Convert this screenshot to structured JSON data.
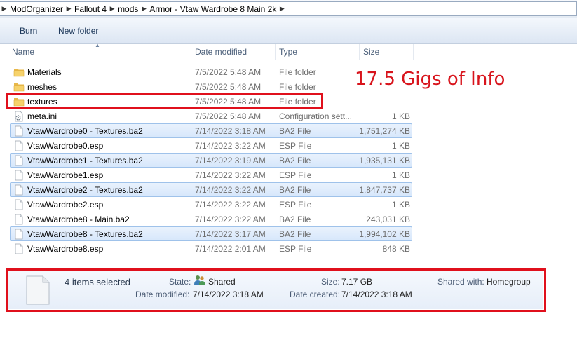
{
  "breadcrumb": [
    "ModOrganizer",
    "Fallout 4",
    "mods",
    "Armor - Vtaw Wardrobe 8 Main 2k"
  ],
  "toolbar": {
    "burn_label": "Burn",
    "new_folder_label": "New folder"
  },
  "columns": {
    "name": "Name",
    "date_modified": "Date modified",
    "type": "Type",
    "size": "Size"
  },
  "files": [
    {
      "name": "Materials",
      "date": "7/5/2022 5:48 AM",
      "type": "File folder",
      "size": "",
      "icon": "folder-icon",
      "selected": false
    },
    {
      "name": "meshes",
      "date": "7/5/2022 5:48 AM",
      "type": "File folder",
      "size": "",
      "icon": "folder-icon",
      "selected": false
    },
    {
      "name": "textures",
      "date": "7/5/2022 5:48 AM",
      "type": "File folder",
      "size": "",
      "icon": "folder-icon",
      "selected": false
    },
    {
      "name": "meta.ini",
      "date": "7/5/2022 5:48 AM",
      "type": "Configuration sett...",
      "size": "1 KB",
      "icon": "settings-file-icon",
      "selected": false
    },
    {
      "name": "VtawWardrobe0 - Textures.ba2",
      "date": "7/14/2022 3:18 AM",
      "type": "BA2 File",
      "size": "1,751,274 KB",
      "icon": "file-icon",
      "selected": true
    },
    {
      "name": "VtawWardrobe0.esp",
      "date": "7/14/2022 3:22 AM",
      "type": "ESP File",
      "size": "1 KB",
      "icon": "file-icon",
      "selected": false
    },
    {
      "name": "VtawWardrobe1 - Textures.ba2",
      "date": "7/14/2022 3:19 AM",
      "type": "BA2 File",
      "size": "1,935,131 KB",
      "icon": "file-icon",
      "selected": true
    },
    {
      "name": "VtawWardrobe1.esp",
      "date": "7/14/2022 3:22 AM",
      "type": "ESP File",
      "size": "1 KB",
      "icon": "file-icon",
      "selected": false
    },
    {
      "name": "VtawWardrobe2 - Textures.ba2",
      "date": "7/14/2022 3:22 AM",
      "type": "BA2 File",
      "size": "1,847,737 KB",
      "icon": "file-icon",
      "selected": true
    },
    {
      "name": "VtawWardrobe2.esp",
      "date": "7/14/2022 3:22 AM",
      "type": "ESP File",
      "size": "1 KB",
      "icon": "file-icon",
      "selected": false
    },
    {
      "name": "VtawWardrobe8 - Main.ba2",
      "date": "7/14/2022 3:22 AM",
      "type": "BA2 File",
      "size": "243,031 KB",
      "icon": "file-icon",
      "selected": false
    },
    {
      "name": "VtawWardrobe8 - Textures.ba2",
      "date": "7/14/2022 3:17 AM",
      "type": "BA2 File",
      "size": "1,994,102 KB",
      "icon": "file-icon",
      "selected": true
    },
    {
      "name": "VtawWardrobe8.esp",
      "date": "7/14/2022 2:01 AM",
      "type": "ESP File",
      "size": "848 KB",
      "icon": "file-icon",
      "selected": false
    }
  ],
  "annotation": {
    "text": "17.5 Gigs of Info",
    "color": "#d8141c"
  },
  "details": {
    "selection": "4 items selected",
    "state_label": "State:",
    "state_value": "Shared",
    "state_icon": "users-icon",
    "size_label": "Size:",
    "size_value": "7.17 GB",
    "shared_with_label": "Shared with:",
    "shared_with_value": "Homegroup",
    "date_modified_label": "Date modified:",
    "date_modified_value": "7/14/2022 3:18 AM",
    "date_created_label": "Date created:",
    "date_created_value": "7/14/2022 3:18 AM"
  }
}
